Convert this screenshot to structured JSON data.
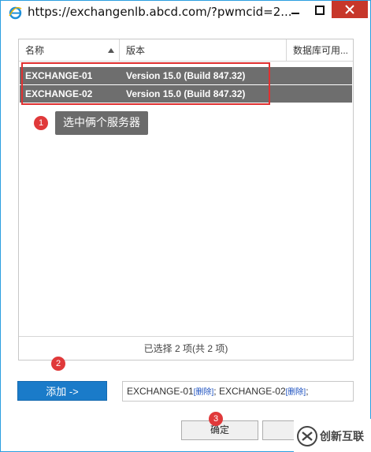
{
  "window": {
    "title": "https://exchangenlb.abcd.com/?pwmcid=2..."
  },
  "grid": {
    "columns": [
      "名称",
      "版本",
      "数据库可用..."
    ],
    "rows": [
      {
        "name": "EXCHANGE-01",
        "version": "Version 15.0 (Build 847.32)"
      },
      {
        "name": "EXCHANGE-02",
        "version": "Version 15.0 (Build 847.32)"
      }
    ],
    "status": "已选择 2 项(共 2 项)"
  },
  "annotations": {
    "step1_number": "1",
    "step1_text": "选中俩个服务器",
    "step2_number": "2",
    "step3_number": "3"
  },
  "actions": {
    "add_label": "添加 ->",
    "ok_label": "确定"
  },
  "selected": {
    "item1": "EXCHANGE-01",
    "item2": "EXCHANGE-02",
    "delete_label": "[删除]",
    "separator": "; ",
    "terminator": ";"
  },
  "watermark": {
    "text": "创新互联"
  },
  "colors": {
    "accent": "#1a7bc9",
    "selected_row": "#6e6e6e",
    "highlight": "#e03030",
    "close_button": "#c7372a"
  }
}
